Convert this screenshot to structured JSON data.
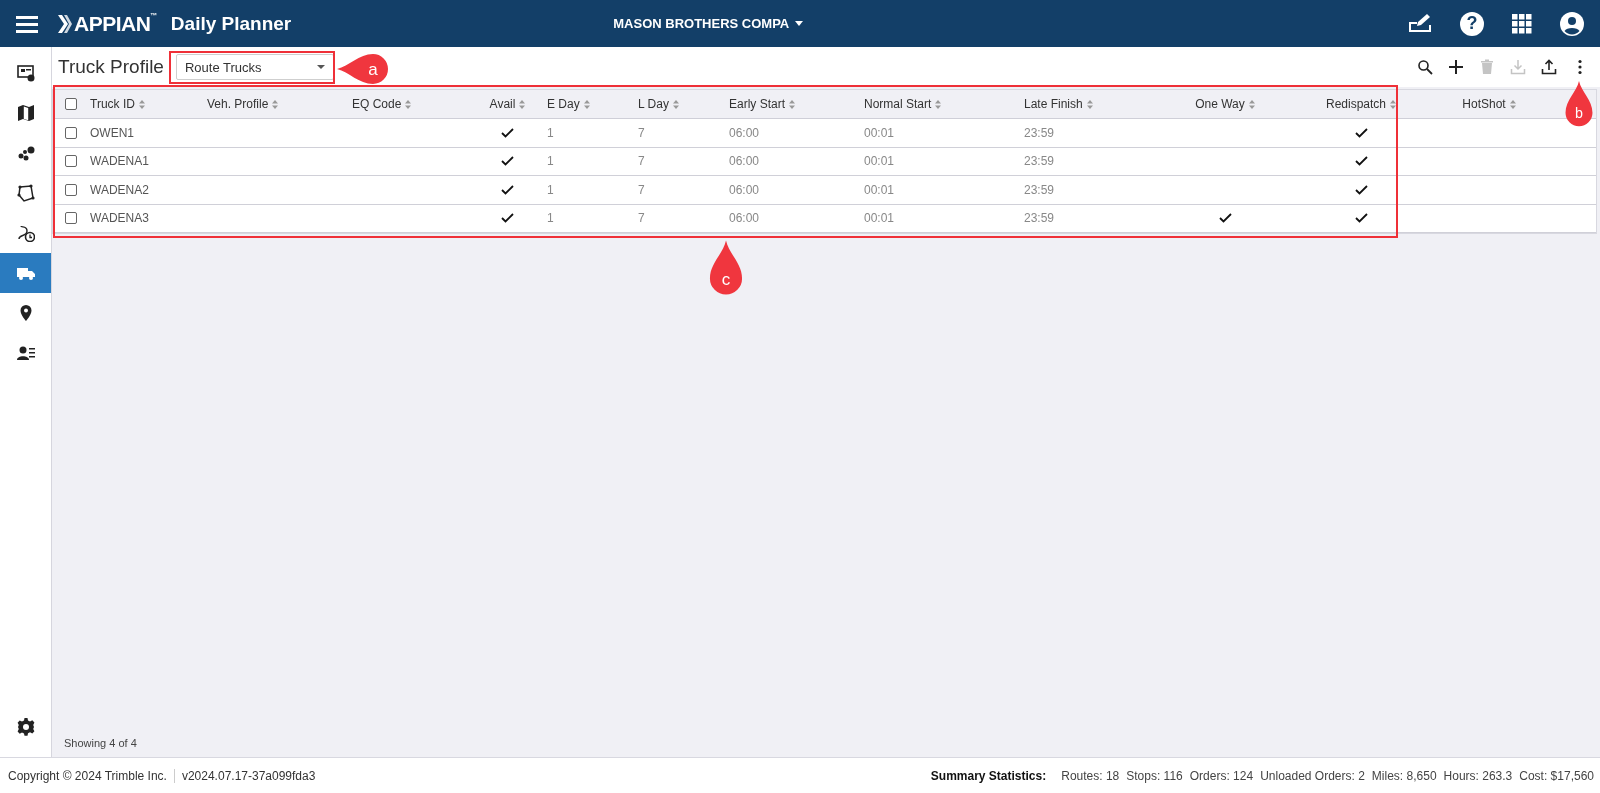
{
  "header": {
    "logo": "APPIAN",
    "logo_mark": "™",
    "app_title": "Daily Planner",
    "company": "MASON BROTHERS COMPA",
    "help_glyph": "?"
  },
  "sidebar": {
    "items": [
      {
        "selected": false
      },
      {
        "selected": false
      },
      {
        "selected": false
      },
      {
        "selected": false
      },
      {
        "selected": false
      },
      {
        "selected": true
      },
      {
        "selected": false
      },
      {
        "selected": false
      }
    ]
  },
  "page": {
    "title": "Truck Profile",
    "view_select": {
      "value": "Route Trucks"
    }
  },
  "toolbar": [
    {
      "kind": "search",
      "disabled": false
    },
    {
      "kind": "add",
      "disabled": false
    },
    {
      "kind": "delete",
      "disabled": true
    },
    {
      "kind": "download",
      "disabled": true
    },
    {
      "kind": "upload",
      "disabled": false
    },
    {
      "kind": "more",
      "disabled": false
    }
  ],
  "table": {
    "all_selected": false,
    "columns": [
      {
        "label": "Truck ID",
        "kind": "text"
      },
      {
        "label": "Veh. Profile",
        "kind": "text"
      },
      {
        "label": "EQ Code",
        "kind": "text"
      },
      {
        "label": "Avail",
        "kind": "check"
      },
      {
        "label": "E Day",
        "kind": "text"
      },
      {
        "label": "L Day",
        "kind": "text"
      },
      {
        "label": "Early Start",
        "kind": "text"
      },
      {
        "label": "Normal Start",
        "kind": "text"
      },
      {
        "label": "Late Finish",
        "kind": "text"
      },
      {
        "label": "One Way",
        "kind": "check"
      },
      {
        "label": "Redispatch",
        "kind": "check"
      },
      {
        "label": "HotShot",
        "kind": "check"
      }
    ],
    "rows": [
      {
        "selected": false,
        "truck_id": "OWEN1",
        "avail": true,
        "e_day": "1",
        "l_day": "7",
        "early_start": "06:00",
        "normal_start": "00:01",
        "late_finish": "23:59",
        "one_way": false,
        "redispatch": true,
        "hotshot": false
      },
      {
        "selected": false,
        "truck_id": "WADENA1",
        "avail": true,
        "e_day": "1",
        "l_day": "7",
        "early_start": "06:00",
        "normal_start": "00:01",
        "late_finish": "23:59",
        "one_way": false,
        "redispatch": true,
        "hotshot": false
      },
      {
        "selected": false,
        "truck_id": "WADENA2",
        "avail": true,
        "e_day": "1",
        "l_day": "7",
        "early_start": "06:00",
        "normal_start": "00:01",
        "late_finish": "23:59",
        "one_way": false,
        "redispatch": true,
        "hotshot": false
      },
      {
        "selected": false,
        "truck_id": "WADENA3",
        "avail": true,
        "e_day": "1",
        "l_day": "7",
        "early_start": "06:00",
        "normal_start": "00:01",
        "late_finish": "23:59",
        "one_way": true,
        "redispatch": true,
        "hotshot": false
      }
    ]
  },
  "record_count": "Showing 4 of 4",
  "status_bar": {
    "copyright": "Copyright © 2024 Trimble Inc.",
    "version": "v2024.07.17-37a099fda3",
    "summary_label": "Summary Statistics:",
    "stats": [
      "Routes: 18",
      "Stops: 116",
      "Orders: 124",
      "Unloaded Orders: 2",
      "Miles: 8,650",
      "Hours: 263.3",
      "Cost: $17,560"
    ]
  },
  "annotations": [
    {
      "label": "a"
    },
    {
      "label": "b"
    },
    {
      "label": "c"
    }
  ]
}
